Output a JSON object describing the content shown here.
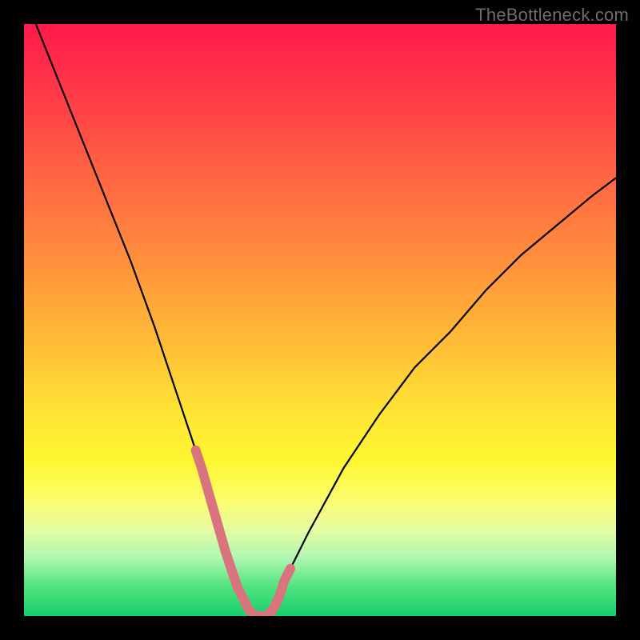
{
  "watermark": "TheBottleneck.com",
  "chart_data": {
    "type": "line",
    "title": "",
    "xlabel": "",
    "ylabel": "",
    "xlim": [
      0,
      100
    ],
    "ylim": [
      0,
      100
    ],
    "series": [
      {
        "name": "bottleneck-curve",
        "x": [
          2,
          6,
          10,
          14,
          18,
          22,
          26,
          30,
          34,
          35,
          36,
          37,
          38,
          39,
          40,
          41,
          42,
          43,
          44,
          48,
          54,
          60,
          66,
          72,
          78,
          84,
          90,
          96,
          100
        ],
        "values": [
          100,
          90,
          80,
          70,
          60,
          49,
          37,
          25,
          11,
          8,
          5,
          3,
          1,
          0,
          0,
          0,
          1,
          3,
          6,
          14,
          25,
          34,
          42,
          48,
          55,
          61,
          66,
          71,
          74
        ]
      }
    ],
    "highlight_segments": [
      {
        "name": "left-pink",
        "x_range": [
          29,
          35
        ],
        "color": "#d9737d"
      },
      {
        "name": "right-pink",
        "x_range": [
          41,
          45
        ],
        "color": "#d9737d"
      },
      {
        "name": "floor-pink",
        "x_range": [
          35,
          41
        ],
        "color": "#d9737d"
      }
    ],
    "background_gradient": {
      "top": "#ff1a4b",
      "mid": "#ffe235",
      "bottom": "#16cf6b"
    }
  }
}
